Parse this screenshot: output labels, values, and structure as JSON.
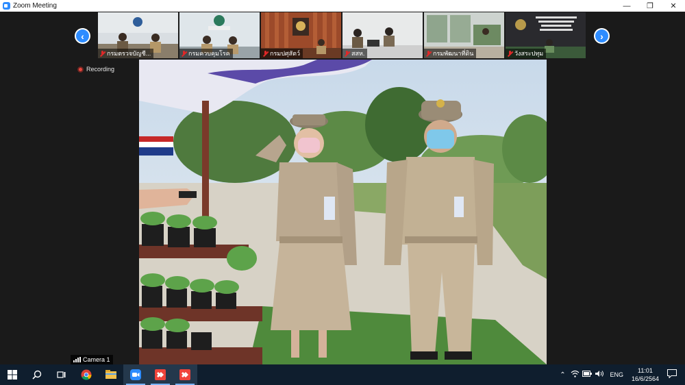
{
  "window": {
    "title": "Zoom Meeting",
    "controls": {
      "minimize": "—",
      "restore": "❐",
      "close": "✕"
    }
  },
  "gallery": {
    "prev_icon": "chevron-left-icon",
    "next_icon": "chevron-right-icon",
    "participants": [
      {
        "name": "กรมตรวจบัญชี...",
        "muted": true
      },
      {
        "name": "กรมควบคุมโรค",
        "muted": true
      },
      {
        "name": "กรมปศุสัตว์",
        "muted": true
      },
      {
        "name": "สสห.",
        "muted": true
      },
      {
        "name": "กรมพัฒนาที่ดิน",
        "muted": true
      },
      {
        "name": "วังสระปทุม",
        "muted": true
      }
    ]
  },
  "meeting": {
    "recording_label": "Recording",
    "camera_label": "Camera 1"
  },
  "taskbar": {
    "apps": [
      "windows-start-icon",
      "search-icon",
      "task-view-icon",
      "chrome-icon",
      "file-explorer-icon",
      "zoom-icon",
      "anydesk-icon",
      "anydesk-icon"
    ],
    "language": "ENG",
    "time": "11:01",
    "date": "16/6/2564"
  },
  "colors": {
    "zoom_blue": "#2d8cff",
    "taskbar_bg": "#0f1e2e",
    "muted_red": "#e02828",
    "record_red": "#e8453c"
  }
}
